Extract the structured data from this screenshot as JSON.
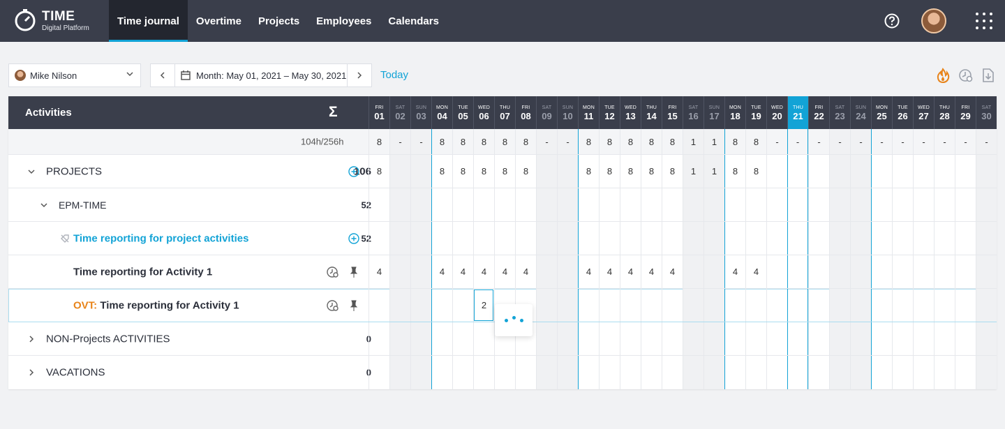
{
  "app": {
    "name": "TIME",
    "subtitle": "Digital Platform"
  },
  "nav": [
    "Time journal",
    "Overtime",
    "Projects",
    "Employees",
    "Calendars"
  ],
  "toolbar": {
    "user": "Mike Nilson",
    "date_range": "Month: May 01, 2021 – May 30, 2021",
    "today": "Today"
  },
  "grid": {
    "activities_label": "Activities",
    "sigma": "Σ",
    "total": "104h/256h",
    "days": [
      {
        "dn": "FRI",
        "dd": "01",
        "wk": false
      },
      {
        "dn": "SAT",
        "dd": "02",
        "wk": true
      },
      {
        "dn": "SUN",
        "dd": "03",
        "wk": true
      },
      {
        "dn": "MON",
        "dd": "04",
        "wk": false
      },
      {
        "dn": "TUE",
        "dd": "05",
        "wk": false
      },
      {
        "dn": "WED",
        "dd": "06",
        "wk": false
      },
      {
        "dn": "THU",
        "dd": "07",
        "wk": false
      },
      {
        "dn": "FRI",
        "dd": "08",
        "wk": false
      },
      {
        "dn": "SAT",
        "dd": "09",
        "wk": true
      },
      {
        "dn": "SUN",
        "dd": "10",
        "wk": true
      },
      {
        "dn": "MON",
        "dd": "11",
        "wk": false
      },
      {
        "dn": "TUE",
        "dd": "12",
        "wk": false
      },
      {
        "dn": "WED",
        "dd": "13",
        "wk": false
      },
      {
        "dn": "THU",
        "dd": "14",
        "wk": false
      },
      {
        "dn": "FRI",
        "dd": "15",
        "wk": false
      },
      {
        "dn": "SAT",
        "dd": "16",
        "wk": true
      },
      {
        "dn": "SUN",
        "dd": "17",
        "wk": true
      },
      {
        "dn": "MON",
        "dd": "18",
        "wk": false
      },
      {
        "dn": "TUE",
        "dd": "19",
        "wk": false
      },
      {
        "dn": "WED",
        "dd": "20",
        "wk": false
      },
      {
        "dn": "THU",
        "dd": "21",
        "wk": false,
        "today": true
      },
      {
        "dn": "FRI",
        "dd": "22",
        "wk": false
      },
      {
        "dn": "SAT",
        "dd": "23",
        "wk": true
      },
      {
        "dn": "SUN",
        "dd": "24",
        "wk": true
      },
      {
        "dn": "MON",
        "dd": "25",
        "wk": false
      },
      {
        "dn": "TUE",
        "dd": "26",
        "wk": false
      },
      {
        "dn": "WED",
        "dd": "27",
        "wk": false
      },
      {
        "dn": "THU",
        "dd": "28",
        "wk": false
      },
      {
        "dn": "FRI",
        "dd": "29",
        "wk": false
      },
      {
        "dn": "SAT",
        "dd": "30",
        "wk": true
      }
    ],
    "summary_values": [
      "8",
      "-",
      "-",
      "8",
      "8",
      "8",
      "8",
      "8",
      "-",
      "-",
      "8",
      "8",
      "8",
      "8",
      "8",
      "1",
      "1",
      "8",
      "8",
      "-",
      "-",
      "-",
      "-",
      "-",
      "-",
      "-",
      "-",
      "-",
      "-",
      "-"
    ],
    "rows": [
      {
        "name": "project-group-row",
        "label": "PROJECTS",
        "total": "106",
        "values": [
          "8",
          "",
          "",
          "8",
          "8",
          "8",
          "8",
          "8",
          "",
          "",
          "8",
          "8",
          "8",
          "8",
          "8",
          "1",
          "1",
          "8",
          "8",
          "",
          "",
          "",
          "",
          "",
          "",
          "",
          "",
          "",
          "",
          ""
        ]
      },
      {
        "name": "epm-time-row",
        "label": "EPM-TIME",
        "total": "52",
        "values": []
      },
      {
        "name": "task-row",
        "label": "Time reporting for project activities",
        "total": "52",
        "values": []
      },
      {
        "name": "activity-row",
        "label": "Time reporting for Activity 1",
        "total": "",
        "values": [
          "4",
          "",
          "",
          "4",
          "4",
          "4",
          "4",
          "4",
          "",
          "",
          "4",
          "4",
          "4",
          "4",
          "4",
          "",
          "",
          "4",
          "4",
          "",
          "",
          "",
          "",
          "",
          "",
          "",
          "",
          "",
          "",
          ""
        ]
      },
      {
        "name": "overtime-row",
        "prefix": "OVT:",
        "label": "Time reporting for Activity 1",
        "total": "",
        "values": [
          "",
          "",
          "",
          "",
          "",
          "2",
          "",
          "",
          "",
          "",
          "",
          "",
          "",
          "",
          "",
          "",
          "",
          "",
          "",
          "",
          "",
          "",
          "",
          "",
          "",
          "",
          "",
          "",
          "",
          ""
        ]
      },
      {
        "name": "non-projects-row",
        "label": "NON-Projects ACTIVITIES",
        "total": "0",
        "values": []
      },
      {
        "name": "vacations-row",
        "label": "VACATIONS",
        "total": "0",
        "values": []
      }
    ]
  },
  "colors": {
    "accent": "#12a3d6",
    "header": "#3a3e4b",
    "overtime": "#e8841a"
  },
  "icons": [
    "logo-icon",
    "help-icon",
    "apps-grid-icon",
    "calendar-icon",
    "fire-icon",
    "clock-settings-icon",
    "export-icon",
    "plus-circle-icon",
    "pin-icon",
    "chevron-down-icon",
    "chevron-right-icon",
    "no-billing-icon"
  ]
}
